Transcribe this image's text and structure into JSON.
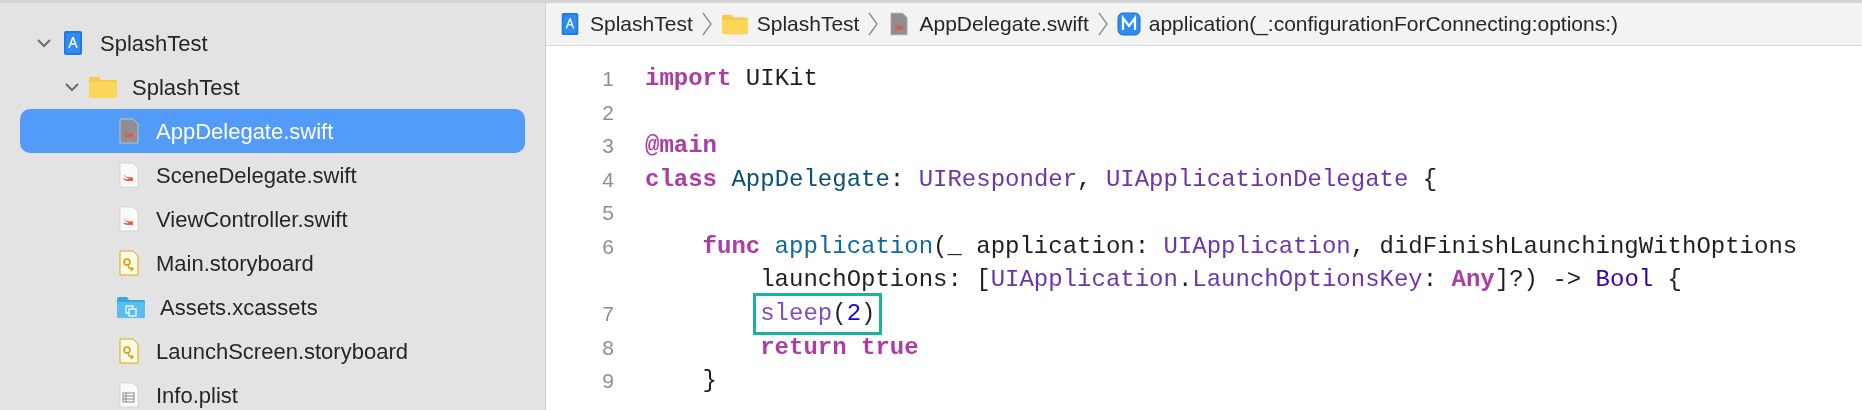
{
  "navigator": {
    "items": [
      {
        "label": "SplashTest",
        "kind": "project",
        "expanded": true,
        "selected": false,
        "children": [
          {
            "label": "SplashTest",
            "kind": "folder",
            "expanded": true,
            "selected": false,
            "children": [
              {
                "label": "AppDelegate.swift",
                "kind": "swift",
                "selected": true
              },
              {
                "label": "SceneDelegate.swift",
                "kind": "swift",
                "selected": false
              },
              {
                "label": "ViewController.swift",
                "kind": "swift",
                "selected": false
              },
              {
                "label": "Main.storyboard",
                "kind": "storyboard",
                "selected": false
              },
              {
                "label": "Assets.xcassets",
                "kind": "assets",
                "selected": false
              },
              {
                "label": "LaunchScreen.storyboard",
                "kind": "storyboard",
                "selected": false
              },
              {
                "label": "Info.plist",
                "kind": "plist",
                "selected": false
              }
            ]
          }
        ]
      }
    ]
  },
  "breadcrumb": [
    {
      "label": "SplashTest",
      "kind": "project"
    },
    {
      "label": "SplashTest",
      "kind": "folder"
    },
    {
      "label": "AppDelegate.swift",
      "kind": "swift"
    },
    {
      "label": "application(_:configurationForConnecting:options:)",
      "kind": "method"
    }
  ],
  "editor": {
    "lines": [
      {
        "number": "1",
        "tokens": [
          {
            "text": "import",
            "kind": "keyword"
          },
          {
            "text": " UIKit",
            "kind": "plain"
          }
        ]
      },
      {
        "number": "2"
      },
      {
        "number": "3",
        "tokens": [
          {
            "text": "@main",
            "kind": "keyword"
          }
        ]
      },
      {
        "number": "4",
        "tokens": [
          {
            "text": "class",
            "kind": "keyword"
          },
          {
            "text": " AppDelegate",
            "kind": "decl"
          },
          {
            "text": ": ",
            "kind": "plain"
          },
          {
            "text": "UIResponder",
            "kind": "type"
          },
          {
            "text": ", ",
            "kind": "plain"
          },
          {
            "text": "UIApplicationDelegate",
            "kind": "type"
          },
          {
            "text": " {",
            "kind": "plain"
          }
        ]
      },
      {
        "number": "5"
      },
      {
        "number": "6",
        "tokens": [
          {
            "text": "    func",
            "kind": "keyword"
          },
          {
            "text": " application",
            "kind": "func"
          },
          {
            "text": "(_ application: ",
            "kind": "plain"
          },
          {
            "text": "UIApplication",
            "kind": "type"
          },
          {
            "text": ", didFinishLaunchingWithOptions",
            "kind": "plain"
          }
        ]
      },
      {
        "tokens": [
          {
            "text": "        launchOptions: [",
            "kind": "plain"
          },
          {
            "text": "UIApplication",
            "kind": "type"
          },
          {
            "text": ".",
            "kind": "plain"
          },
          {
            "text": "LaunchOptionsKey",
            "kind": "type"
          },
          {
            "text": ": ",
            "kind": "plain"
          },
          {
            "text": "Any",
            "kind": "keyword"
          },
          {
            "text": "]?) -> ",
            "kind": "plain"
          },
          {
            "text": "Bool",
            "kind": "systype"
          },
          {
            "text": " {",
            "kind": "plain"
          }
        ]
      },
      {
        "number": "7",
        "highlighted": true,
        "tokens": [
          {
            "text": "        sleep",
            "kind": "call"
          },
          {
            "text": "(",
            "kind": "plain"
          },
          {
            "text": "2",
            "kind": "number"
          },
          {
            "text": ")",
            "kind": "plain"
          }
        ]
      },
      {
        "number": "8",
        "tokens": [
          {
            "text": "        return",
            "kind": "keyword"
          },
          {
            "text": " true",
            "kind": "keyword"
          }
        ]
      },
      {
        "number": "9",
        "tokens": [
          {
            "text": "    }",
            "kind": "plain"
          }
        ]
      }
    ]
  }
}
